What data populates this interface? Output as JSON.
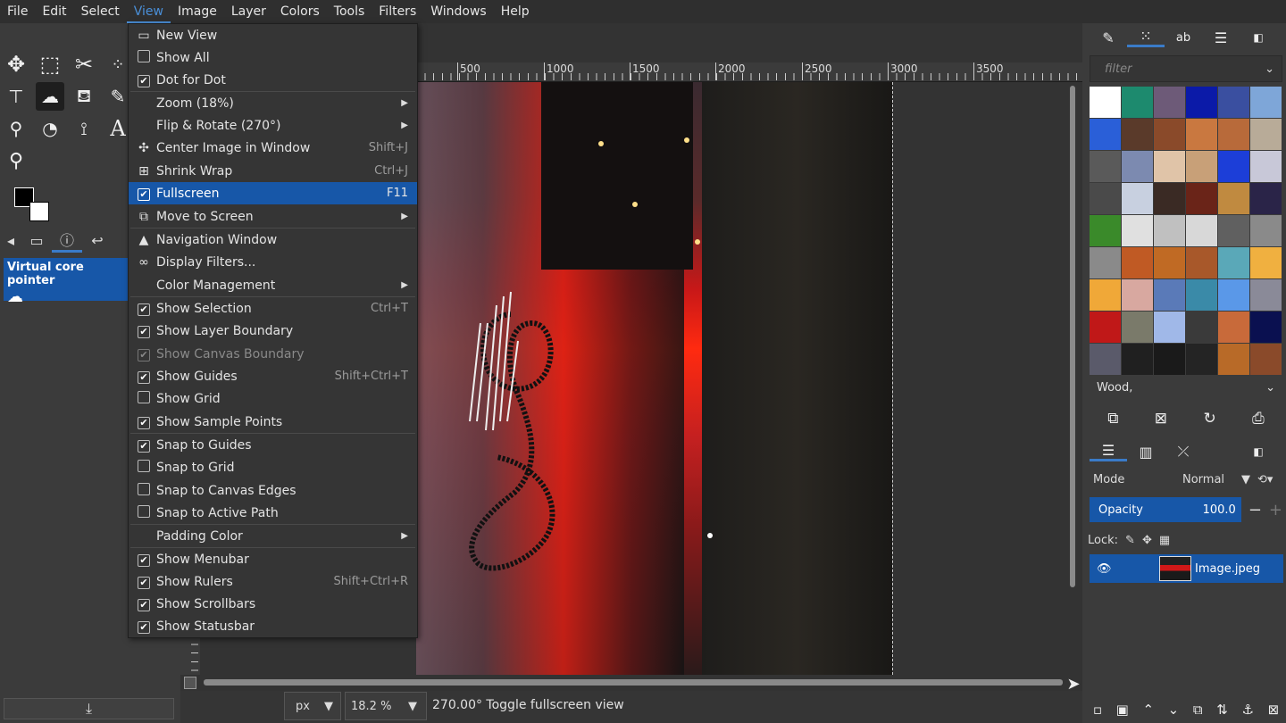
{
  "menubar": {
    "items": [
      "File",
      "Edit",
      "Select",
      "View",
      "Image",
      "Layer",
      "Colors",
      "Tools",
      "Filters",
      "Windows",
      "Help"
    ],
    "active": "View"
  },
  "toolbox": {
    "device_label": "Virtual core pointer"
  },
  "view_menu": {
    "new_view": "New View",
    "show_all": "Show All",
    "dot_for_dot": "Dot for Dot",
    "zoom": "Zoom (18%)",
    "flip_rotate": "Flip & Rotate (270°)",
    "center_image": "Center Image in Window",
    "center_image_sc": "Shift+J",
    "shrink_wrap": "Shrink Wrap",
    "shrink_wrap_sc": "Ctrl+J",
    "fullscreen": "Fullscreen",
    "fullscreen_sc": "F11",
    "move_to_screen": "Move to Screen",
    "navigation_window": "Navigation Window",
    "display_filters": "Display Filters...",
    "color_management": "Color Management",
    "show_selection": "Show Selection",
    "show_selection_sc": "Ctrl+T",
    "show_layer_boundary": "Show Layer Boundary",
    "show_canvas_boundary": "Show Canvas Boundary",
    "show_guides": "Show Guides",
    "show_guides_sc": "Shift+Ctrl+T",
    "show_grid": "Show Grid",
    "show_sample_points": "Show Sample Points",
    "snap_to_guides": "Snap to Guides",
    "snap_to_grid": "Snap to Grid",
    "snap_to_canvas_edges": "Snap to Canvas Edges",
    "snap_to_active_path": "Snap to Active Path",
    "padding_color": "Padding Color",
    "show_menubar": "Show Menubar",
    "show_rulers": "Show Rulers",
    "show_rulers_sc": "Shift+Ctrl+R",
    "show_scrollbars": "Show Scrollbars",
    "show_statusbar": "Show Statusbar"
  },
  "ruler": {
    "labels": [
      "500",
      "1000",
      "1500",
      "2000",
      "2500",
      "3000",
      "3500"
    ]
  },
  "statusbar": {
    "unit": "px",
    "zoom": "18.2 %",
    "message": "270.00° Toggle fullscreen view"
  },
  "patterns_panel": {
    "filter_placeholder": "filter",
    "selected_pattern": "Wood,",
    "swatches": [
      "#ffffff",
      "#1d8a6e",
      "#6d5a78",
      "#0b1aa8",
      "#3a4fa0",
      "#7ea6d8",
      "#2a5fd8",
      "#5a3a2a",
      "#8a4a2a",
      "#c97840",
      "#b86a3a",
      "#b8ab98",
      "#5a5a5a",
      "#7c8ab0",
      "#e0c4a8",
      "#c8a078",
      "#1c3ed8",
      "#c8c8d8",
      "#4a4a4a",
      "#c8d0e0",
      "#3a2a24",
      "#6a2418",
      "#c08a40",
      "#2a2448",
      "#3a8a2a",
      "#e0e0e0",
      "#c0c0c0",
      "#d8d8d8",
      "#606060",
      "#8a8a8a",
      "#8a8a8a",
      "#c05a24",
      "#c06a24",
      "#a8582a",
      "#5aa8b8",
      "#f0b040",
      "#f0a838",
      "#d8a8a0",
      "#5a7ab8",
      "#3a8aa8",
      "#5a98e8",
      "#8a8a98",
      "#c01818",
      "#7a7a6a",
      "#a0b8e8",
      "#3a3a3a",
      "#c86a3a",
      "#0a1050",
      "#5a5a6a",
      "#202020",
      "#1a1a1a",
      "#242424",
      "#b86a28",
      "#8a4a2a"
    ]
  },
  "layers_panel": {
    "mode_label": "Mode",
    "mode_value": "Normal",
    "opacity_label": "Opacity",
    "opacity_value": "100.0",
    "lock_label": "Lock:",
    "layer_name": "Image.jpeg"
  }
}
